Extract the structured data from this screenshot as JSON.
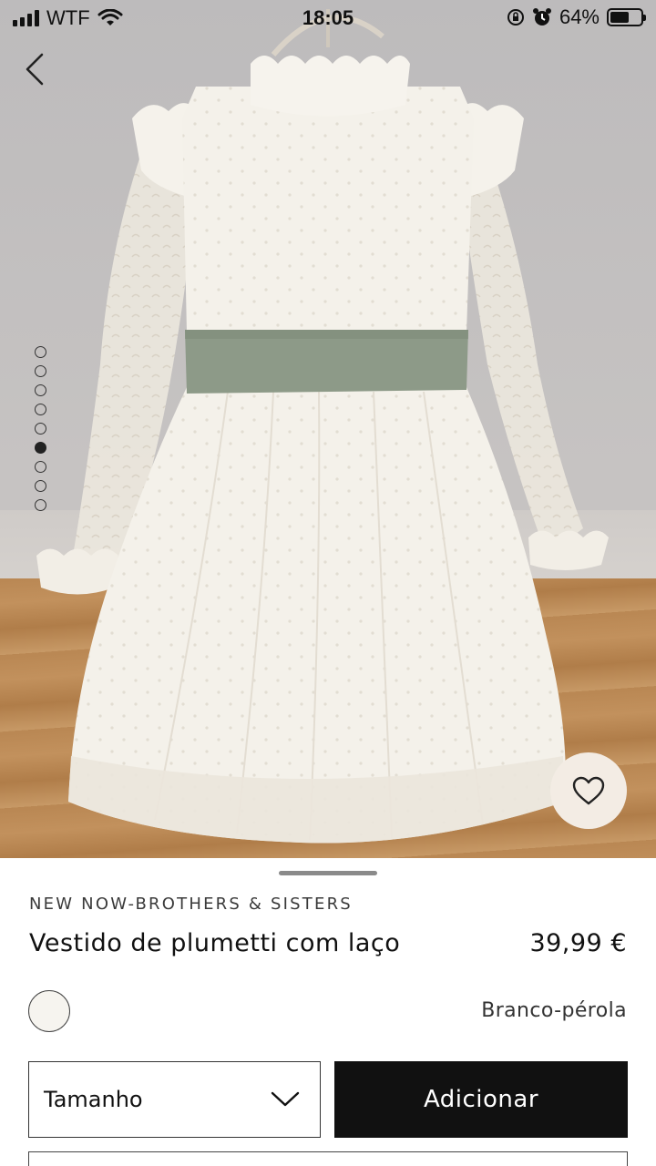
{
  "status_bar": {
    "carrier": "WTF",
    "time": "18:05",
    "battery": "64%",
    "battery_level": 0.64
  },
  "gallery": {
    "image_count": 9,
    "active_index": 5
  },
  "product": {
    "collection": "NEW NOW-BROTHERS & SISTERS",
    "title": "Vestido de plumetti com laço",
    "price": "39,99 €",
    "color_name": "Branco-pérola",
    "swatch_color": "#f6f4ef"
  },
  "actions": {
    "size_label": "Tamanho",
    "add_label": "Adicionar"
  },
  "icons": {
    "back": "chevron-left-icon",
    "favorite": "heart-icon",
    "dropdown": "chevron-down-icon"
  },
  "colors": {
    "sash": "#8d9a88",
    "dress": "#f4f1ea",
    "button": "#111111"
  }
}
